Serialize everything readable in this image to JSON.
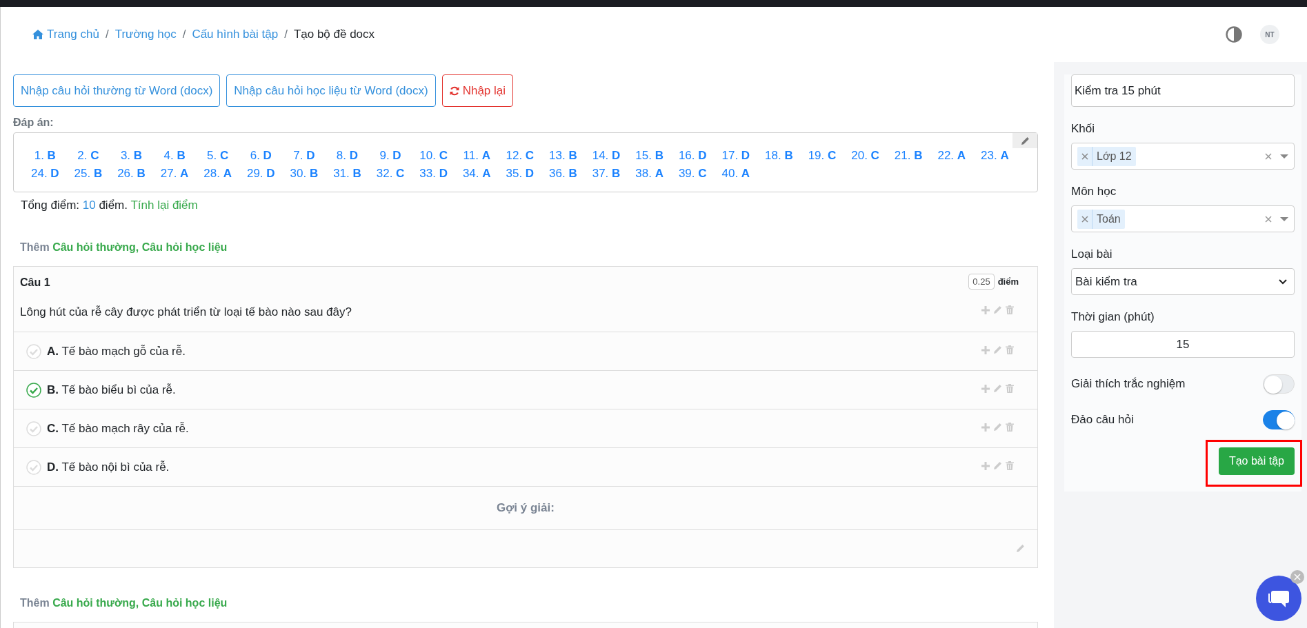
{
  "breadcrumb": {
    "items": [
      {
        "label": "Trang chủ",
        "link": true,
        "home": true
      },
      {
        "label": "Trường học",
        "link": true,
        "home": false
      },
      {
        "label": "Cấu hình bài tập",
        "link": true,
        "home": false
      },
      {
        "label": "Tạo bộ đề docx",
        "link": false,
        "home": false
      }
    ],
    "separator": "/",
    "avatar": "NT"
  },
  "import_buttons": [
    {
      "label": "Nhập câu hỏi thường từ Word (docx)",
      "kind": "primary"
    },
    {
      "label": "Nhập câu hỏi học liệu từ Word (docx)",
      "kind": "primary"
    },
    {
      "label": "Nhập lại",
      "kind": "danger"
    }
  ],
  "answer_key": {
    "label": "Đáp án:",
    "items": [
      {
        "number": "1.",
        "answer": "B"
      },
      {
        "number": "2.",
        "answer": "C"
      },
      {
        "number": "3.",
        "answer": "B"
      },
      {
        "number": "4.",
        "answer": "B"
      },
      {
        "number": "5.",
        "answer": "C"
      },
      {
        "number": "6.",
        "answer": "D"
      },
      {
        "number": "7.",
        "answer": "D"
      },
      {
        "number": "8.",
        "answer": "D"
      },
      {
        "number": "9.",
        "answer": "D"
      },
      {
        "number": "10.",
        "answer": "C"
      },
      {
        "number": "11.",
        "answer": "A"
      },
      {
        "number": "12.",
        "answer": "C"
      },
      {
        "number": "13.",
        "answer": "B"
      },
      {
        "number": "14.",
        "answer": "D"
      },
      {
        "number": "15.",
        "answer": "B"
      },
      {
        "number": "16.",
        "answer": "D"
      },
      {
        "number": "17.",
        "answer": "D"
      },
      {
        "number": "18.",
        "answer": "B"
      },
      {
        "number": "19.",
        "answer": "C"
      },
      {
        "number": "20.",
        "answer": "C"
      },
      {
        "number": "21.",
        "answer": "B"
      },
      {
        "number": "22.",
        "answer": "A"
      },
      {
        "number": "23.",
        "answer": "A"
      },
      {
        "number": "24.",
        "answer": "D"
      },
      {
        "number": "25.",
        "answer": "B"
      },
      {
        "number": "26.",
        "answer": "B"
      },
      {
        "number": "27.",
        "answer": "A"
      },
      {
        "number": "28.",
        "answer": "A"
      },
      {
        "number": "29.",
        "answer": "D"
      },
      {
        "number": "30.",
        "answer": "B"
      },
      {
        "number": "31.",
        "answer": "B"
      },
      {
        "number": "32.",
        "answer": "C"
      },
      {
        "number": "33.",
        "answer": "D"
      },
      {
        "number": "34.",
        "answer": "A"
      },
      {
        "number": "35.",
        "answer": "D"
      },
      {
        "number": "36.",
        "answer": "B"
      },
      {
        "number": "37.",
        "answer": "B"
      },
      {
        "number": "38.",
        "answer": "A"
      },
      {
        "number": "39.",
        "answer": "C"
      },
      {
        "number": "40.",
        "answer": "A"
      }
    ]
  },
  "total": {
    "label": "Tổng điểm:",
    "value": "10",
    "unit": "điểm.",
    "recalc": "Tính lại điểm"
  },
  "sections": [
    {
      "kind": "add",
      "label": "Thêm",
      "links": [
        "Câu hỏi thường",
        "Câu hỏi học liệu"
      ],
      "separator": ","
    },
    {
      "kind": "question",
      "title": "Câu 1",
      "score": "0.25",
      "score_unit": "điểm",
      "text": "Lông hút của rễ cây được phát triển từ loại tế bào nào sau đây?",
      "options": [
        {
          "letter": "A.",
          "text": "Tế bào mạch gỗ của rễ.",
          "correct": false
        },
        {
          "letter": "B.",
          "text": "Tế bào biểu bì của rễ.",
          "correct": true
        },
        {
          "letter": "C.",
          "text": "Tế bào mạch rây của rễ.",
          "correct": false
        },
        {
          "letter": "D.",
          "text": "Tế bào nội bì của rễ.",
          "correct": false
        }
      ],
      "hint_label": "Gợi ý giải:"
    },
    {
      "kind": "add",
      "label": "Thêm",
      "links": [
        "Câu hỏi thường",
        "Câu hỏi học liệu"
      ],
      "separator": ","
    },
    {
      "kind": "question_cut"
    }
  ],
  "settings": {
    "title_value": "Kiểm tra 15 phút",
    "fields": [
      {
        "kind": "tags",
        "label": "Khối",
        "tags": [
          "Lớp 12"
        ]
      },
      {
        "kind": "tags",
        "label": "Môn học",
        "tags": [
          "Toán"
        ]
      },
      {
        "kind": "select",
        "label": "Loại bài",
        "value": "Bài kiểm tra"
      },
      {
        "kind": "number",
        "label": "Thời gian (phút)",
        "value": "15"
      },
      {
        "kind": "toggle",
        "label": "Giải thích trắc nghiệm",
        "on": false
      },
      {
        "kind": "toggle",
        "label": "Đảo câu hỏi",
        "on": true
      }
    ],
    "submit": {
      "label": "Tạo bài tập",
      "highlighted": true
    }
  }
}
